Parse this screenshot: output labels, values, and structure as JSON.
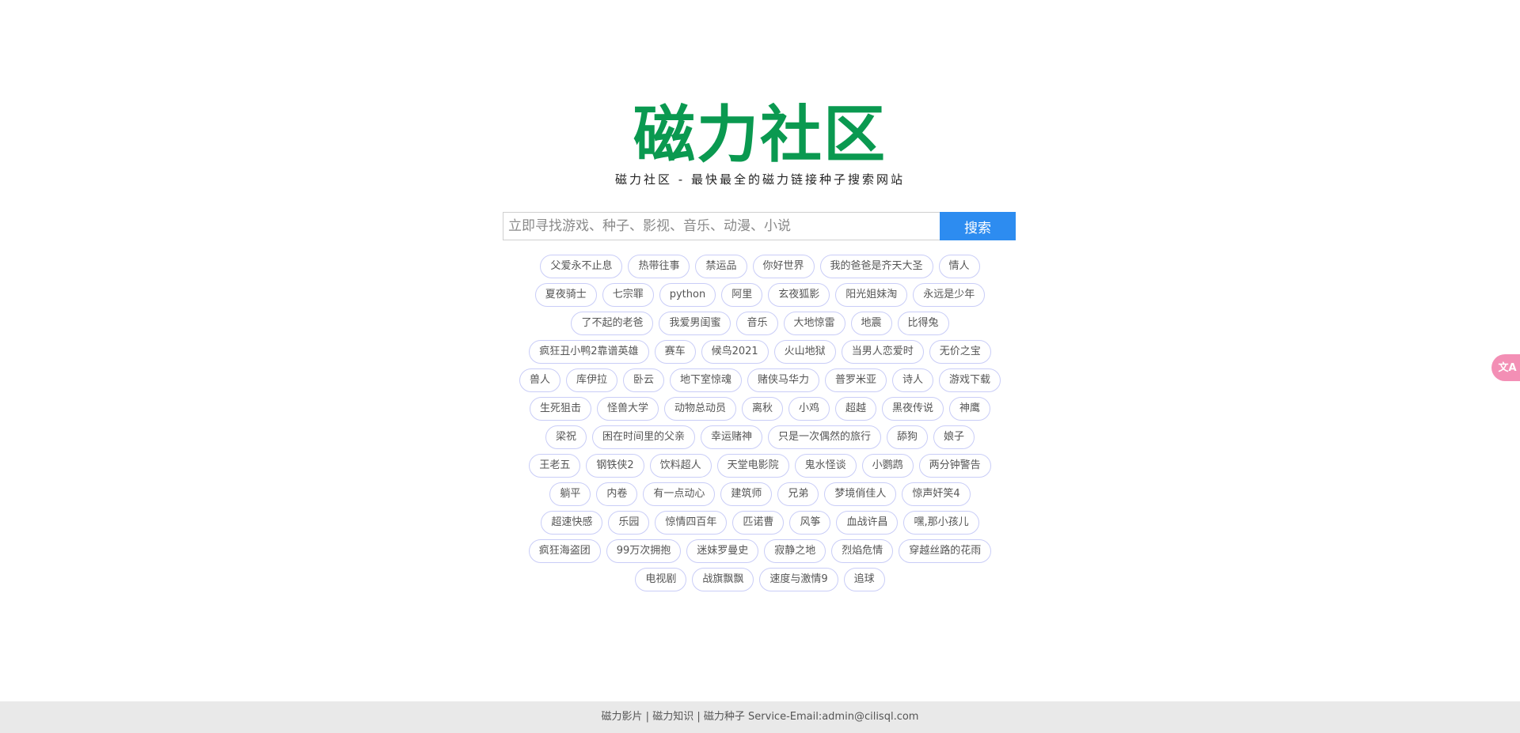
{
  "logo": {
    "text": "磁力社区"
  },
  "subtitle": "磁力社区 - 最快最全的磁力链接种子搜索网站",
  "search": {
    "placeholder": "立即寻找游戏、种子、影视、音乐、动漫、小说",
    "value": "",
    "button_label": "搜索"
  },
  "tag_rows": [
    [
      "父爱永不止息",
      "热带往事",
      "禁运品",
      "你好世界",
      "我的爸爸是齐天大圣",
      "情人"
    ],
    [
      "夏夜骑士",
      "七宗罪",
      "python",
      "阿里",
      "玄夜狐影",
      "阳光姐妹淘",
      "永远是少年"
    ],
    [
      "了不起的老爸",
      "我爱男闺蜜",
      "音乐",
      "大地惊雷",
      "地震",
      "比得兔"
    ],
    [
      "疯狂丑小鸭2靠谱英雄",
      "赛车",
      "候鸟2021",
      "火山地狱",
      "当男人恋爱时",
      "无价之宝"
    ],
    [
      "兽人",
      "库伊拉",
      "卧云",
      "地下室惊魂",
      "赌侠马华力",
      "普罗米亚",
      "诗人",
      "游戏下载"
    ],
    [
      "生死狙击",
      "怪兽大学",
      "动物总动员",
      "离秋",
      "小鸡",
      "超越",
      "黑夜传说",
      "神鹰"
    ],
    [
      "梁祝",
      "困在时间里的父亲",
      "幸运赌神",
      "只是一次偶然的旅行",
      "舔狗",
      "娘子"
    ],
    [
      "王老五",
      "钢铁侠2",
      "饮料超人",
      "天堂电影院",
      "鬼水怪谈",
      "小鹦鹉",
      "两分钟警告"
    ],
    [
      "躺平",
      "内卷",
      "有一点动心",
      "建筑师",
      "兄弟",
      "梦境俏佳人",
      "惊声奸笑4"
    ],
    [
      "超速快感",
      "乐园",
      "惊情四百年",
      "匹诺曹",
      "风筝",
      "血战许昌",
      "嘿,那小孩儿"
    ],
    [
      "疯狂海盗团",
      "99万次拥抱",
      "迷妹罗曼史",
      "寂静之地",
      "烈焰危情",
      "穿越丝路的花雨"
    ],
    [
      "电视剧",
      "战旗飘飘",
      "速度与激情9",
      "追球"
    ]
  ],
  "float_button": {
    "icon": "translate-icon",
    "text": "文A"
  },
  "footer": {
    "links": [
      "磁力影片",
      "磁力知识",
      "磁力种子"
    ],
    "separator": " | ",
    "contact": "Service-Email:admin@cilisql.com"
  },
  "colors": {
    "brand_green": "#0a9950",
    "search_button": "#2d8cf0",
    "tag_border": "#c9cdf7",
    "footer_bg": "#e9e9e9",
    "float_button": "#f38fb5"
  }
}
